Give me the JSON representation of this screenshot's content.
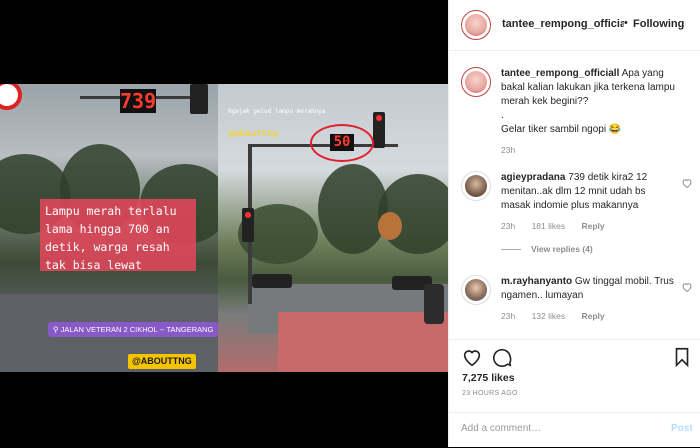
{
  "photo": {
    "left_counter": "739",
    "right_counter": "50",
    "red_box_text": "Lampu merah terlalu lama hingga 700 an detik, warga resah tak bisa lewat",
    "location_tag": "JALAN VETERAN 2 CIKHOL -- TANGERANG",
    "handle_left": "@ABOUTTNG",
    "handle_right": "@abouttng",
    "caption_small": "Ngajak gelud lampu merahnya"
  },
  "header": {
    "username": "tantee_rempong_officiall",
    "separator": "•",
    "follow_label": "Following"
  },
  "caption": {
    "username": "tantee_rempong_officiall",
    "text_1": "Apa yang bakal kalian lakukan jika terkena lampu merah kek begini??",
    "text_2": ".",
    "text_3": "Gelar tiker sambil ngopi 😂",
    "time": "23h"
  },
  "comments": [
    {
      "username": "agieypradana",
      "text": "739 detik kira2 12 menitan..ak dlm 12 mnit udah bs masak indomie plus makannya",
      "time": "23h",
      "likes": "181 likes",
      "reply": "Reply",
      "view_replies": "View replies (4)"
    },
    {
      "username": "m.rayhanyanto",
      "text": "Gw tinggal mobil. Trus ngamen.. lumayan",
      "time": "23h",
      "likes": "132 likes",
      "reply": "Reply"
    }
  ],
  "actions": {
    "likes": "7,275 likes",
    "date": "23 HOURS AGO",
    "comment_placeholder": "Add a comment…",
    "post_label": "Post"
  }
}
